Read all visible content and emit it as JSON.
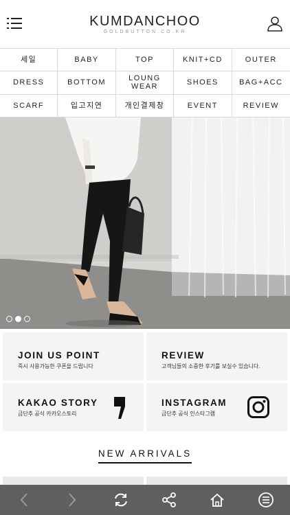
{
  "header": {
    "logo_main": "KUMDANCHOO",
    "logo_sub": "GOLDBUTTON.CO.KR",
    "menu_icon": "list-menu-icon",
    "user_icon": "user-icon"
  },
  "categories": [
    [
      "세일",
      "BABY",
      "TOP",
      "KNIT+CD",
      "OUTER"
    ],
    [
      "DRESS",
      "BOTTOM",
      "LOUNG WEAR",
      "SHOES",
      "BAG+ACC"
    ],
    [
      "SCARF",
      "입고지연",
      "개인결제창",
      "EVENT",
      "REVIEW"
    ]
  ],
  "banner": {
    "slide_count": 3,
    "active_slide": 2
  },
  "promos": [
    {
      "title": "JOIN US POINT",
      "subtitle": "즉시 사용가능한 쿠폰을 드립니다"
    },
    {
      "title": "REVIEW",
      "subtitle": "고객님들의 소중한 후기를 보실수 있습니다."
    },
    {
      "title": "KAKAO STORY",
      "subtitle": "금단추 공식 카카오스토리",
      "icon": "kakao-story-icon"
    },
    {
      "title": "INSTAGRAM",
      "subtitle": "금단추 공식 인스타그램",
      "icon": "instagram-icon"
    }
  ],
  "section_title": "NEW ARRIVALS",
  "toolbar": {
    "items": [
      "back-icon",
      "forward-icon",
      "refresh-icon",
      "share-icon",
      "home-icon",
      "menu-circle-icon"
    ]
  },
  "colors": {
    "toolbar_bg": "#5f5f5f",
    "card_bg": "#f4f4f4",
    "grid_border": "#d9d9d9"
  }
}
